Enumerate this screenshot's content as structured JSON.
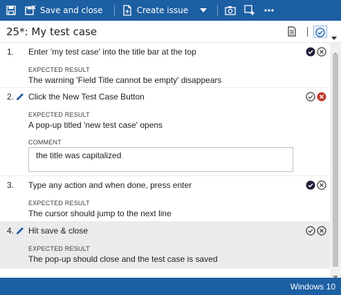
{
  "toolbar": {
    "save_close_label": "Save and close",
    "create_issue_label": "Create issue",
    "icons": [
      "save-icon",
      "save-close-icon",
      "create-issue-icon",
      "dropdown-icon",
      "camera-icon",
      "capture-add-icon",
      "more-icon"
    ]
  },
  "header": {
    "title": "25*: My test case"
  },
  "labels": {
    "expected_result": "EXPECTED RESULT",
    "comment": "COMMENT"
  },
  "steps": [
    {
      "number": "1.",
      "action": "Enter 'my test case' into the title bar at the top",
      "expected": "The warning 'Field Title cannot be empty' disappears",
      "status": "passed"
    },
    {
      "number": "2.",
      "action": "Click the New Test Case Button",
      "expected": "A pop-up titled 'new test case' opens",
      "comment": "the title was capitalized",
      "status": "failed"
    },
    {
      "number": "3.",
      "action": "Type any action and when done, press enter",
      "expected": "The cursor should jump to the next line",
      "status": "passed"
    },
    {
      "number": "4.",
      "action": "Hit save & close",
      "expected": "The pop-up should close and the test case is saved",
      "status": "none"
    }
  ],
  "statusbar": {
    "text": "Windows 10"
  },
  "colors": {
    "toolbar_bg": "#1c5fa3",
    "fail_red": "#c0392b",
    "pass_dark": "#1f1f3a",
    "selected_row": "#e9ebed"
  }
}
